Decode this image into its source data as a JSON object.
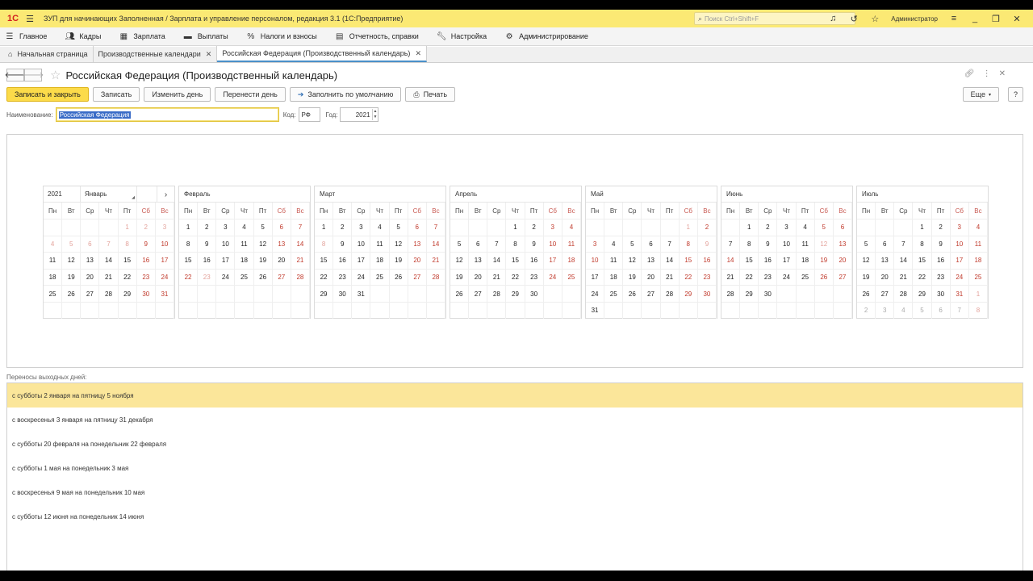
{
  "window": {
    "logo": "1С",
    "title": "ЗУП для начинающих Заполненная / Зарплата и управление персоналом, редакция 3.1  (1С:Предприятие)",
    "search_placeholder": "Поиск Ctrl+Shift+F",
    "user": "Администратор"
  },
  "menu": [
    {
      "label": "Главное",
      "icon": "menu-lines-icon"
    },
    {
      "label": "Кадры",
      "icon": "people-icon"
    },
    {
      "label": "Зарплата",
      "icon": "calculator-icon"
    },
    {
      "label": "Выплаты",
      "icon": "wallet-icon"
    },
    {
      "label": "Налоги и взносы",
      "icon": "percent-icon"
    },
    {
      "label": "Отчетность, справки",
      "icon": "report-icon"
    },
    {
      "label": "Настройка",
      "icon": "wrench-icon"
    },
    {
      "label": "Администрирование",
      "icon": "gear-icon"
    }
  ],
  "tabs": [
    {
      "label": "Начальная страница"
    },
    {
      "label": "Производственные календари"
    },
    {
      "label": "Российская Федерация (Производственный календарь)"
    }
  ],
  "form": {
    "title": "Российская Федерация (Производственный календарь)",
    "buttons": {
      "save_close": "Записать и закрыть",
      "save": "Записать",
      "change_day": "Изменить день",
      "move_day": "Перенести день",
      "fill_default": "Заполнить по умолчанию",
      "print": "Печать",
      "more": "Еще",
      "help": "?"
    },
    "fields": {
      "name_label": "Наименование:",
      "name_value": "Российская Федерация",
      "code_label": "Код:",
      "code_value": "РФ",
      "year_label": "Год:",
      "year_value": "2021"
    }
  },
  "calendar": {
    "year": "2021",
    "next_arrow": "›",
    "weekdays": [
      "Пн",
      "Вт",
      "Ср",
      "Чт",
      "Пт",
      "Сб",
      "Вс"
    ],
    "months": [
      {
        "name": "Январь",
        "days": [
          "",
          "",
          "",
          "",
          "1",
          "2",
          "3",
          "4",
          "5",
          "6",
          "7",
          "8",
          "9",
          "10",
          "11",
          "12",
          "13",
          "14",
          "15",
          "16",
          "17",
          "18",
          "19",
          "20",
          "21",
          "22",
          "23",
          "24",
          "25",
          "26",
          "27",
          "28",
          "29",
          "30",
          "31",
          "",
          "",
          "",
          "",
          "",
          "",
          ""
        ],
        "states": [
          "e",
          "e",
          "e",
          "e",
          "oh",
          "oh",
          "oh",
          "oh",
          "oh",
          "oh",
          "oh",
          "oh",
          "h",
          "h",
          "n",
          "n",
          "n",
          "n",
          "n",
          "h",
          "h",
          "n",
          "n",
          "n",
          "n",
          "n",
          "h",
          "h",
          "n",
          "n",
          "n",
          "n",
          "n",
          "h",
          "h",
          "e",
          "e",
          "e",
          "e",
          "e",
          "e",
          "e"
        ]
      },
      {
        "name": "Февраль",
        "days": [
          "1",
          "2",
          "3",
          "4",
          "5",
          "6",
          "7",
          "8",
          "9",
          "10",
          "11",
          "12",
          "13",
          "14",
          "15",
          "16",
          "17",
          "18",
          "19",
          "20",
          "21",
          "22",
          "23",
          "24",
          "25",
          "26",
          "27",
          "28",
          "",
          "",
          "",
          "",
          "",
          "",
          "",
          "",
          "",
          "",
          "",
          "",
          "",
          ""
        ],
        "states": [
          "n",
          "n",
          "n",
          "n",
          "n",
          "h",
          "h",
          "n",
          "n",
          "n",
          "n",
          "n",
          "h",
          "h",
          "n",
          "n",
          "n",
          "n",
          "n",
          "n",
          "h",
          "h",
          "oh",
          "n",
          "n",
          "n",
          "h",
          "h",
          "e",
          "e",
          "e",
          "e",
          "e",
          "e",
          "e",
          "e",
          "e",
          "e",
          "e",
          "e",
          "e",
          "e"
        ]
      },
      {
        "name": "Март",
        "days": [
          "1",
          "2",
          "3",
          "4",
          "5",
          "6",
          "7",
          "8",
          "9",
          "10",
          "11",
          "12",
          "13",
          "14",
          "15",
          "16",
          "17",
          "18",
          "19",
          "20",
          "21",
          "22",
          "23",
          "24",
          "25",
          "26",
          "27",
          "28",
          "29",
          "30",
          "31",
          "",
          "",
          "",
          "",
          "",
          "",
          "",
          "",
          "",
          "",
          ""
        ],
        "states": [
          "n",
          "n",
          "n",
          "n",
          "n",
          "h",
          "h",
          "oh",
          "n",
          "n",
          "n",
          "n",
          "h",
          "h",
          "n",
          "n",
          "n",
          "n",
          "n",
          "h",
          "h",
          "n",
          "n",
          "n",
          "n",
          "n",
          "h",
          "h",
          "n",
          "n",
          "n",
          "e",
          "e",
          "e",
          "e",
          "e",
          "e",
          "e",
          "e",
          "e",
          "e",
          "e"
        ]
      },
      {
        "name": "Апрель",
        "days": [
          "",
          "",
          "",
          "1",
          "2",
          "3",
          "4",
          "5",
          "6",
          "7",
          "8",
          "9",
          "10",
          "11",
          "12",
          "13",
          "14",
          "15",
          "16",
          "17",
          "18",
          "19",
          "20",
          "21",
          "22",
          "23",
          "24",
          "25",
          "26",
          "27",
          "28",
          "29",
          "30",
          "",
          "",
          "",
          "",
          "",
          "",
          "",
          "",
          ""
        ],
        "states": [
          "e",
          "e",
          "e",
          "n",
          "n",
          "h",
          "h",
          "n",
          "n",
          "n",
          "n",
          "n",
          "h",
          "h",
          "n",
          "n",
          "n",
          "n",
          "n",
          "h",
          "h",
          "n",
          "n",
          "n",
          "n",
          "n",
          "h",
          "h",
          "n",
          "n",
          "n",
          "n",
          "n",
          "e",
          "e",
          "e",
          "e",
          "e",
          "e",
          "e",
          "e",
          "e"
        ]
      },
      {
        "name": "Май",
        "days": [
          "",
          "",
          "",
          "",
          "",
          "1",
          "2",
          "3",
          "4",
          "5",
          "6",
          "7",
          "8",
          "9",
          "10",
          "11",
          "12",
          "13",
          "14",
          "15",
          "16",
          "17",
          "18",
          "19",
          "20",
          "21",
          "22",
          "23",
          "24",
          "25",
          "26",
          "27",
          "28",
          "29",
          "30",
          "31",
          "",
          "",
          "",
          "",
          "",
          ""
        ],
        "states": [
          "e",
          "e",
          "e",
          "e",
          "e",
          "oh",
          "h",
          "h",
          "n",
          "n",
          "n",
          "n",
          "h",
          "oh",
          "h",
          "n",
          "n",
          "n",
          "n",
          "h",
          "h",
          "n",
          "n",
          "n",
          "n",
          "n",
          "h",
          "h",
          "n",
          "n",
          "n",
          "n",
          "n",
          "h",
          "h",
          "n",
          "e",
          "e",
          "e",
          "e",
          "e",
          "e"
        ]
      },
      {
        "name": "Июнь",
        "days": [
          "",
          "1",
          "2",
          "3",
          "4",
          "5",
          "6",
          "7",
          "8",
          "9",
          "10",
          "11",
          "12",
          "13",
          "14",
          "15",
          "16",
          "17",
          "18",
          "19",
          "20",
          "21",
          "22",
          "23",
          "24",
          "25",
          "26",
          "27",
          "28",
          "29",
          "30",
          "",
          "",
          "",
          "",
          "",
          "",
          "",
          "",
          "",
          "",
          ""
        ],
        "states": [
          "e",
          "n",
          "n",
          "n",
          "n",
          "h",
          "h",
          "n",
          "n",
          "n",
          "n",
          "n",
          "oh",
          "h",
          "h",
          "n",
          "n",
          "n",
          "n",
          "h",
          "h",
          "n",
          "n",
          "n",
          "n",
          "n",
          "h",
          "h",
          "n",
          "n",
          "n",
          "e",
          "e",
          "e",
          "e",
          "e",
          "e",
          "e",
          "e",
          "e",
          "e",
          "e"
        ]
      },
      {
        "name": "Июль",
        "days": [
          "",
          "",
          "",
          "1",
          "2",
          "3",
          "4",
          "5",
          "6",
          "7",
          "8",
          "9",
          "10",
          "11",
          "12",
          "13",
          "14",
          "15",
          "16",
          "17",
          "18",
          "19",
          "20",
          "21",
          "22",
          "23",
          "24",
          "25",
          "26",
          "27",
          "28",
          "29",
          "30",
          "31",
          "1",
          "2",
          "3",
          "4",
          "5",
          "6",
          "7",
          "8"
        ],
        "states": [
          "e",
          "e",
          "e",
          "n",
          "n",
          "h",
          "h",
          "n",
          "n",
          "n",
          "n",
          "n",
          "h",
          "h",
          "n",
          "n",
          "n",
          "n",
          "n",
          "h",
          "h",
          "n",
          "n",
          "n",
          "n",
          "n",
          "h",
          "h",
          "n",
          "n",
          "n",
          "n",
          "n",
          "h",
          "oh",
          "o",
          "o",
          "o",
          "o",
          "o",
          "o",
          "oh"
        ]
      }
    ]
  },
  "transfers": {
    "label": "Переносы выходных дней:",
    "items": [
      "с субботы 2 января на пятницу 5 ноября",
      "с воскресенья 3 января на пятницу 31 декабря",
      "с субботы 20 февраля на понедельник 22 февраля",
      "с субботы 1 мая на понедельник 3 мая",
      "с воскресенья 9 мая на понедельник 10 мая",
      "с субботы 12 июня на понедельник 14 июня"
    ]
  },
  "colors": {
    "titlebar": "#fbe974",
    "primary_button": "#fcdb4a",
    "holiday": "#c0392b",
    "selected_row": "#fbe69a"
  }
}
